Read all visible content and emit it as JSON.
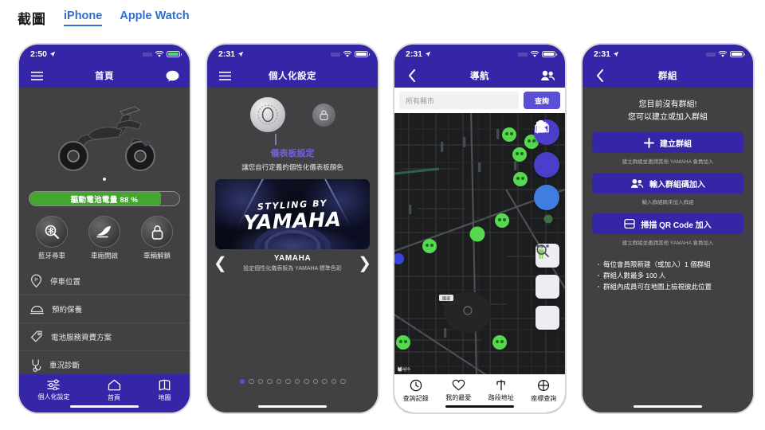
{
  "header": {
    "title": "截圖",
    "tabs": [
      {
        "label": "iPhone",
        "active": true
      },
      {
        "label": "Apple Watch",
        "active": false
      }
    ],
    "accent_color": "#2f6fd0"
  },
  "theme": {
    "brand_purple": "#3426a6",
    "accent_purple": "#5b4fd6",
    "battery_green": "#43a62f",
    "screen_dark": "#414143"
  },
  "phones": [
    {
      "id": "home",
      "status": {
        "time": "2:50",
        "location_icon": "location-arrow-icon",
        "wifi_icon": "wifi-icon",
        "battery_icon": "battery-icon",
        "battery_charged": true
      },
      "nav": {
        "left_icon": "hamburger-menu-icon",
        "title": "首頁",
        "right_icon": "chat-bubble-icon"
      },
      "hero": {
        "image_alt": "electric-scooter",
        "page_dots": 1
      },
      "battery_bar": {
        "label": "驅動電池電量 88 %",
        "percent": 88
      },
      "quick_actions": [
        {
          "label": "藍牙尋車",
          "icon": "bluetooth-find-vehicle-icon"
        },
        {
          "label": "車廂開啟",
          "icon": "seat-open-icon"
        },
        {
          "label": "車輛解鎖",
          "icon": "lock-unlock-icon"
        }
      ],
      "menu": [
        {
          "label": "停車位置",
          "icon": "parking-pin-icon"
        },
        {
          "label": "預約保養",
          "icon": "service-dome-icon"
        },
        {
          "label": "電池服務資費方案",
          "icon": "price-tag-icon"
        },
        {
          "label": "車況診斷",
          "icon": "stethoscope-icon"
        }
      ],
      "tabbar": [
        {
          "label": "個人化設定",
          "icon": "sliders-icon"
        },
        {
          "label": "首頁",
          "icon": "home-icon"
        },
        {
          "label": "地圖",
          "icon": "map-icon"
        }
      ]
    },
    {
      "id": "personalization",
      "status": {
        "time": "2:31",
        "location_icon": "location-arrow-icon",
        "wifi_icon": "wifi-icon",
        "battery_icon": "battery-icon",
        "battery_charged": false
      },
      "nav": {
        "left_icon": "hamburger-menu-icon",
        "title": "個人化設定",
        "right_icon": ""
      },
      "icons": [
        {
          "name": "dashboard-dial-icon"
        },
        {
          "name": "lock-icon"
        }
      ],
      "section_title": "儀表板設定",
      "section_sub": "讓您自行定義的個性化儀表板顏色",
      "card": {
        "styling_text": "STYLING BY",
        "brand_text": "YAMAHA",
        "caption_title": "YAMAHA",
        "caption_sub": "設定個性化儀表板為 YAMAHA 標準色彩",
        "prev_icon": "chevron-left-icon",
        "next_icon": "chevron-right-icon"
      },
      "pager": {
        "count": 12,
        "active_index": 0
      }
    },
    {
      "id": "navigation",
      "status": {
        "time": "2:31",
        "location_icon": "location-arrow-icon",
        "wifi_icon": "wifi-icon",
        "battery_icon": "battery-icon",
        "battery_charged": false
      },
      "nav": {
        "left_icon": "chevron-back-icon",
        "title": "導航",
        "right_icon": "group-people-icon"
      },
      "search": {
        "placeholder": "所有縣市",
        "value": "",
        "button_label": "查詢"
      },
      "map": {
        "attribution": "Maps",
        "attribution_icon": "apple-logo-icon",
        "marker_count": 9,
        "marker_color": "#57d94f"
      },
      "fabs": [
        {
          "icon": "battery-charging-icon",
          "color": "#4a3ecb"
        },
        {
          "icon": "garage-vehicle-icon",
          "color": "#4a3ecb"
        },
        {
          "icon": "tools-wrench-icon",
          "color": "#3f7ee0"
        }
      ],
      "square_buttons": [
        {
          "icon": "pegman-street-view-icon"
        },
        {
          "icon": "magnifier-icon"
        },
        {
          "icon": "more-dots-icon"
        }
      ],
      "tabbar": [
        {
          "label": "查詢記錄",
          "icon": "clock-history-icon"
        },
        {
          "label": "我的最愛",
          "icon": "heart-icon"
        },
        {
          "label": "路段地址",
          "icon": "road-sign-icon"
        },
        {
          "label": "座標查詢",
          "icon": "crosshair-icon"
        }
      ]
    },
    {
      "id": "groups",
      "status": {
        "time": "2:31",
        "location_icon": "location-arrow-icon",
        "wifi_icon": "wifi-icon",
        "battery_icon": "battery-icon",
        "battery_charged": false
      },
      "nav": {
        "left_icon": "chevron-back-icon",
        "title": "群組",
        "right_icon": ""
      },
      "headline_line1": "您目前沒有群組!",
      "headline_line2": "您可以建立或加入群組",
      "buttons": [
        {
          "label": "建立群組",
          "icon": "plus-icon",
          "hint": "建立群組並邀請其他 YAMAHA 會員加入"
        },
        {
          "label": "輸入群組碼加入",
          "icon": "group-people-icon",
          "hint": "輸入群組碼來加入群組"
        },
        {
          "label": "掃描 QR Code 加入",
          "icon": "qr-scan-icon",
          "hint": "建立群組並邀請其他 YAMAHA 會員加入"
        }
      ],
      "bullets": [
        "每位會員限新建（或加入）1 個群組",
        "群組人數最多 100 人",
        "群組內成員可在地圖上檢視彼此位置"
      ]
    }
  ]
}
